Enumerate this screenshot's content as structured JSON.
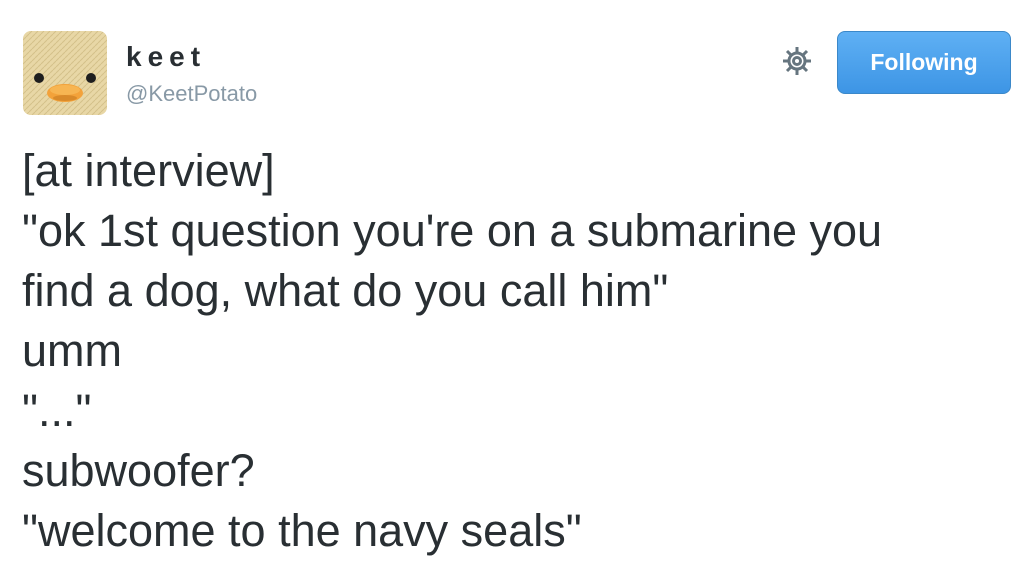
{
  "author": {
    "display_name": "keet",
    "handle": "@KeetPotato",
    "avatar_icon": "duck-face-icon"
  },
  "actions": {
    "settings_icon": "gear-icon",
    "follow_label": "Following"
  },
  "tweet": {
    "lines": [
      "[at interview]",
      "\"ok 1st question you're on a submarine you",
      "find a dog, what do you call him\"",
      "umm",
      "\"...\"",
      "subwoofer?",
      "\"welcome to the navy seals\""
    ]
  },
  "colors": {
    "button_blue": "#4aa1ec",
    "text_dark": "#292f33",
    "text_muted": "#8899a6"
  }
}
